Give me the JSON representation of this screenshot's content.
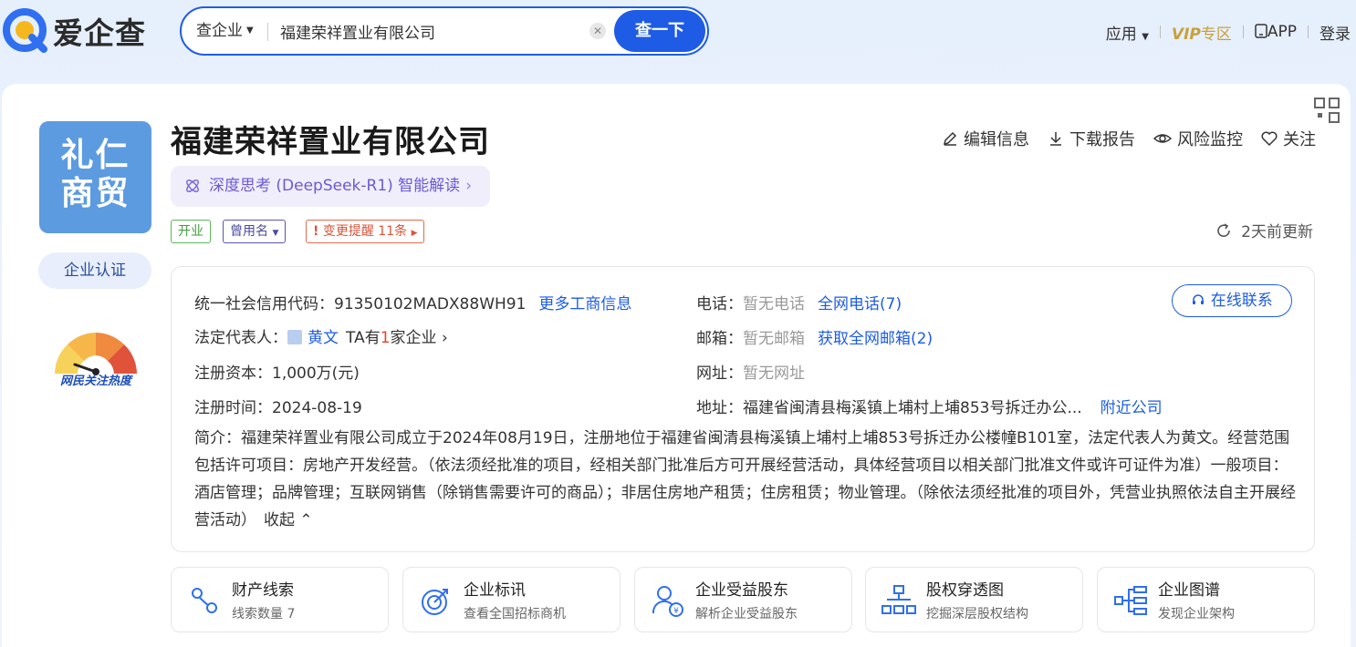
{
  "brand": {
    "name": "爱企查"
  },
  "search": {
    "type_label": "查企业",
    "value": "福建荣祥置业有限公司",
    "button_label": "查一下"
  },
  "nav": {
    "apps": "应用",
    "vip": "VIP",
    "vip_zone": "专区",
    "app": "APP",
    "login": "登录"
  },
  "company": {
    "logo_text_line1": "礼仁",
    "logo_text_line2": "商贸",
    "name": "福建荣祥置业有限公司",
    "ai_interpret": "深度思考 (DeepSeek-R1) 智能解读",
    "cert_label": "企业认证",
    "heat_label": "网民关注热度",
    "tags": {
      "status": "开业",
      "former_name": "曾用名",
      "change_alert": "变更提醒 11条"
    },
    "actions": {
      "edit": "编辑信息",
      "download": "下载报告",
      "monitor": "风险监控",
      "follow": "关注"
    },
    "updated": "2天前更新"
  },
  "info": {
    "credit_code_label": "统一社会信用代码：",
    "credit_code": "91350102MADX88WH91",
    "more_business": "更多工商信息",
    "legal_rep_label": "法定代表人：",
    "legal_rep": "黄文",
    "legal_rep_ta_prefix": "TA有",
    "legal_rep_count": "1",
    "legal_rep_ta_suffix": "家企业",
    "capital_label": "注册资本：",
    "capital": "1,000万(元)",
    "reg_time_label": "注册时间：",
    "reg_time": "2024-08-19",
    "phone_label": "电话：",
    "phone": "暂无电话",
    "phone_link": "全网电话(7)",
    "email_label": "邮箱：",
    "email": "暂无邮箱",
    "email_link": "获取全网邮箱(2)",
    "website_label": "网址：",
    "website": "暂无网址",
    "address_label": "地址：",
    "address": "福建省闽清县梅溪镇上埔村上埔853号拆迁办公...",
    "nearby": "附近公司",
    "contact_online": "在线联系",
    "intro_label": "简介：",
    "intro": "福建荣祥置业有限公司成立于2024年08月19日，注册地位于福建省闽清县梅溪镇上埔村上埔853号拆迁办公楼幢B101室，法定代表人为黄文。经营范围包括许可项目：房地产开发经营。（依法须经批准的项目，经相关部门批准后方可开展经营活动，具体经营项目以相关部门批准文件或许可证件为准）一般项目：酒店管理；品牌管理；互联网销售（除销售需要许可的商品）；非居住房地产租赁；住房租赁；物业管理。（除依法须经批准的项目外，凭营业执照依法自主开展经营活动）",
    "collapse": "收起"
  },
  "cards": [
    {
      "title": "财产线索",
      "sub": "线索数量 7"
    },
    {
      "title": "企业标讯",
      "sub": "查看全国招标商机"
    },
    {
      "title": "企业受益股东",
      "sub": "解析企业受益股东"
    },
    {
      "title": "股权穿透图",
      "sub": "挖掘深层股权结构"
    },
    {
      "title": "企业图谱",
      "sub": "发现企业架构"
    }
  ],
  "colors": {
    "primary": "#1e5ce6",
    "logo_bg": "#5d9be0",
    "vip_gold": "#c8a13a",
    "alert_red": "#e0452b"
  }
}
